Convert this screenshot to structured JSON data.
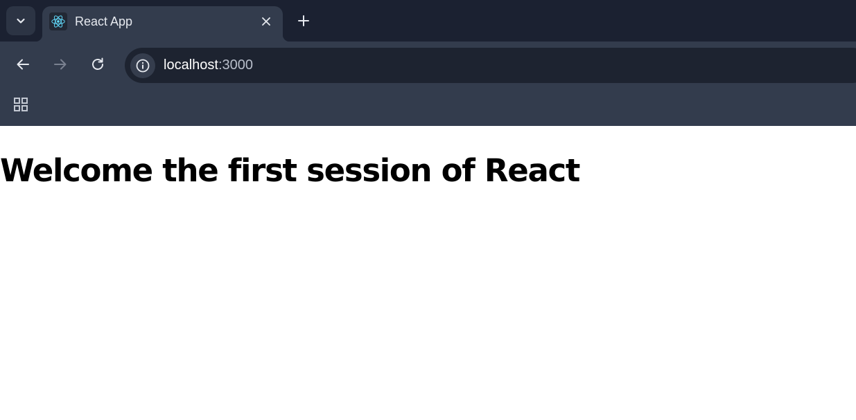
{
  "browser": {
    "tab": {
      "title": "React App"
    },
    "address_bar": {
      "host": "localhost",
      "port": ":3000"
    }
  },
  "icons": {
    "tab_search": "chevron-down-icon",
    "favicon": "react-logo-icon",
    "tab_close": "close-icon",
    "new_tab": "plus-icon",
    "back": "arrow-left-icon",
    "forward": "arrow-right-icon",
    "reload": "reload-icon",
    "site_info": "info-icon",
    "apps": "apps-grid-icon"
  },
  "colors": {
    "tab_strip": "#1b2131",
    "toolbar": "#333c4d",
    "omnibox": "#1d2330",
    "react_accent": "#61dafb"
  },
  "page": {
    "heading": "Welcome the first session of React"
  }
}
